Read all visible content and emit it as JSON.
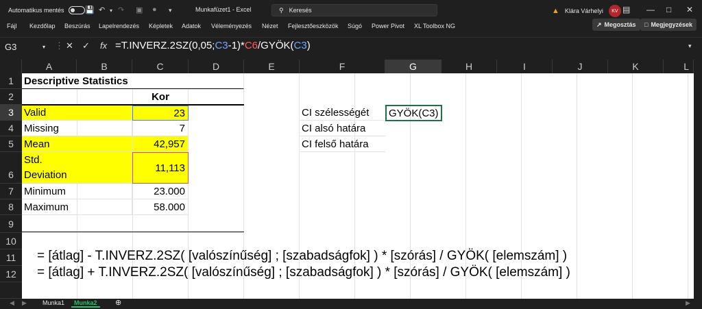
{
  "titlebar": {
    "autosave_label": "Automatikus mentés",
    "doc_title": "Munkafüzet1  -  Excel",
    "search_placeholder": "Keresés",
    "user_name": "Klára Várhelyi",
    "user_initials": "KV"
  },
  "menu": {
    "items": [
      "Fájl",
      "Kezdőlap",
      "Beszúrás",
      "Lapelrendezés",
      "Képletek",
      "Adatok",
      "Véleményezés",
      "Nézet",
      "Fejlesztőeszközök",
      "Súgó",
      "Power Pivot",
      "XL Toolbox NG"
    ],
    "share_label": "Megosztás",
    "comments_label": "Megjegyzések"
  },
  "formula_bar": {
    "name_box": "G3",
    "formula_parts": [
      "=T.INVERZ.2SZ(0,05;",
      "C3",
      "-1)*",
      "C6",
      "/GYÖK(",
      "C3",
      ")"
    ]
  },
  "grid": {
    "columns": [
      "A",
      "B",
      "C",
      "D",
      "E",
      "F",
      "G",
      "H",
      "I",
      "J",
      "K",
      "L"
    ],
    "rows": [
      "1",
      "2",
      "3",
      "4",
      "5",
      "6",
      "7",
      "8",
      "9",
      "10",
      "11",
      "12"
    ],
    "title": "Descriptive Statistics",
    "header_kor": "Kor",
    "stats": [
      {
        "label": "Valid",
        "value": "23"
      },
      {
        "label": "Missing",
        "value": "7"
      },
      {
        "label": "Mean",
        "value": "42,957"
      },
      {
        "label": "Std. Deviation",
        "value": "11,113"
      },
      {
        "label": "Minimum",
        "value": "23.000"
      },
      {
        "label": "Maximum",
        "value": "58.000"
      }
    ],
    "ci_labels": [
      "CI szélességét",
      "CI alsó határa",
      "CI felső határa"
    ],
    "g3_value": "GYÖK(C3)",
    "formula_line_11": "= [átlag]  - T.INVERZ.2SZ( [valószínűség] ; [szabadságfok] ) * [szórás] / GYÖK( [elemszám] )",
    "formula_line_12": "= [átlag] + T.INVERZ.2SZ( [valószínűség] ; [szabadságfok] ) * [szórás] / GYÖK( [elemszám] )"
  },
  "sheets": {
    "tabs": [
      "Munka1",
      "Munka2"
    ],
    "active": "Munka2"
  }
}
